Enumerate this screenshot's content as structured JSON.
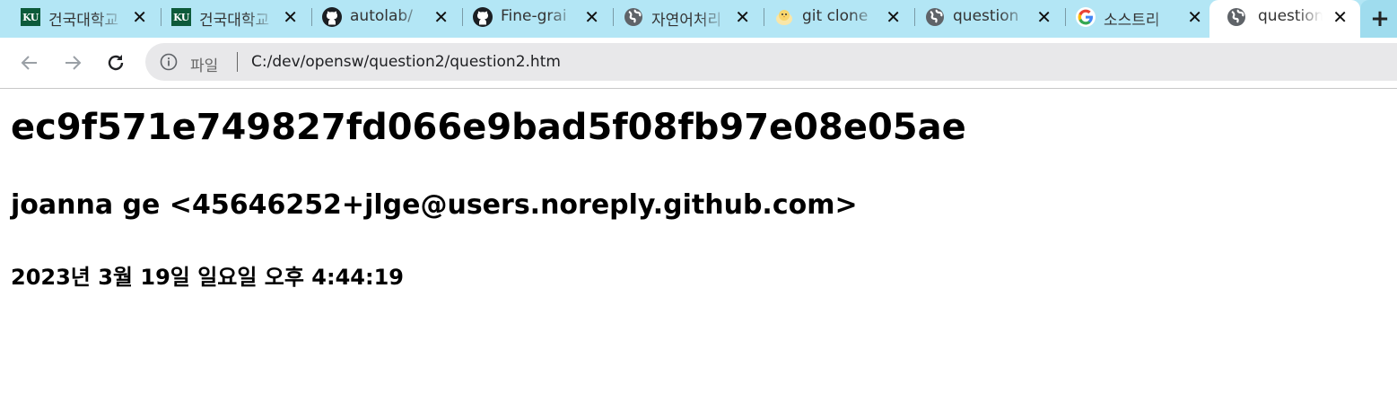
{
  "tabs": [
    {
      "title": "건국대학교",
      "icon": "ku-logo-icon",
      "active": false
    },
    {
      "title": "건국대학교",
      "icon": "ku-logo-icon",
      "active": false
    },
    {
      "title": "autolab/",
      "icon": "github-icon",
      "active": false
    },
    {
      "title": "Fine-grai",
      "icon": "github-icon",
      "active": false
    },
    {
      "title": "자연어처리",
      "icon": "globe-icon",
      "active": false
    },
    {
      "title": "git clone",
      "icon": "chick-icon",
      "active": false
    },
    {
      "title": "question",
      "icon": "globe-icon",
      "active": false
    },
    {
      "title": "소스트리",
      "icon": "google-icon",
      "active": false
    },
    {
      "title": "question",
      "icon": "globe-icon",
      "active": true
    }
  ],
  "tab_close_glyph": "✕",
  "new_tab_glyph": "+",
  "toolbar": {
    "scheme_label": "파일",
    "url": "C:/dev/opensw/question2/question2.htm"
  },
  "content": {
    "commit_hash": "ec9f571e749827fd066e9bad5f08fb97e08e05ae",
    "author": "joanna ge <45646252+jlge@users.noreply.github.com>",
    "date": "2023년 3월 19일 일요일 오후 4:44:19"
  },
  "colors": {
    "tab_strip": "#b3e6f5",
    "active_tab": "#ffffff",
    "omnibox": "#e8e8ea",
    "ku_green": "#0d5a3a"
  }
}
